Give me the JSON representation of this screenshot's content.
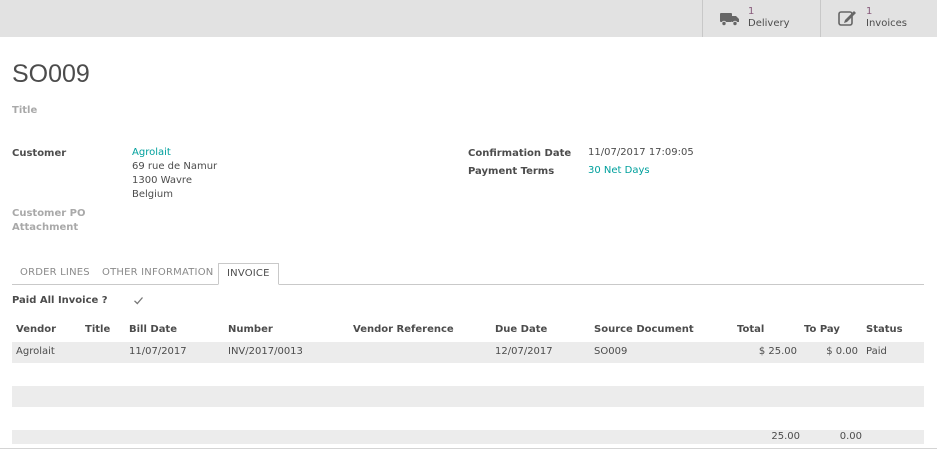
{
  "stat_buttons": {
    "delivery": {
      "count": "1",
      "label": "Delivery",
      "icon": "truck-icon"
    },
    "invoices": {
      "count": "1",
      "label": "Invoices",
      "icon": "pencil-square-icon"
    }
  },
  "order": {
    "name": "SO009",
    "title_placeholder": "Title"
  },
  "fields": {
    "customer_label": "Customer",
    "customer_name": "Agrolait",
    "address_line1": "69 rue de Namur",
    "address_line2": "1300 Wavre",
    "address_line3": "Belgium",
    "customer_po_label": "Customer PO",
    "attachment_label": "Attachment",
    "confirmation_date_label": "Confirmation Date",
    "confirmation_date": "11/07/2017 17:09:05",
    "payment_terms_label": "Payment Terms",
    "payment_terms": "30 Net Days"
  },
  "tabs": [
    {
      "label": "ORDER LINES"
    },
    {
      "label": "OTHER INFORMATION"
    },
    {
      "label": "INVOICE"
    }
  ],
  "invoice_tab": {
    "paid_all_label": "Paid All Invoice ?",
    "paid_all_checked": true
  },
  "table": {
    "headers": {
      "vendor": "Vendor",
      "title": "Title",
      "bill_date": "Bill Date",
      "number": "Number",
      "vendor_reference": "Vendor Reference",
      "due_date": "Due Date",
      "source_document": "Source Document",
      "total": "Total",
      "to_pay": "To Pay",
      "status": "Status"
    },
    "rows": [
      {
        "vendor": "Agrolait",
        "title": "",
        "bill_date": "11/07/2017",
        "number": "INV/2017/0013",
        "vendor_reference": "",
        "due_date": "12/07/2017",
        "source_document": "SO009",
        "total": "$ 25.00",
        "to_pay": "$ 0.00",
        "status": "Paid"
      }
    ],
    "footer": {
      "total": "25.00",
      "to_pay": "0.00"
    }
  },
  "colors": {
    "link": "#00a09d",
    "accent": "#875a7b",
    "row_bg": "#ececec",
    "topbar_bg": "#e2e2e2"
  }
}
